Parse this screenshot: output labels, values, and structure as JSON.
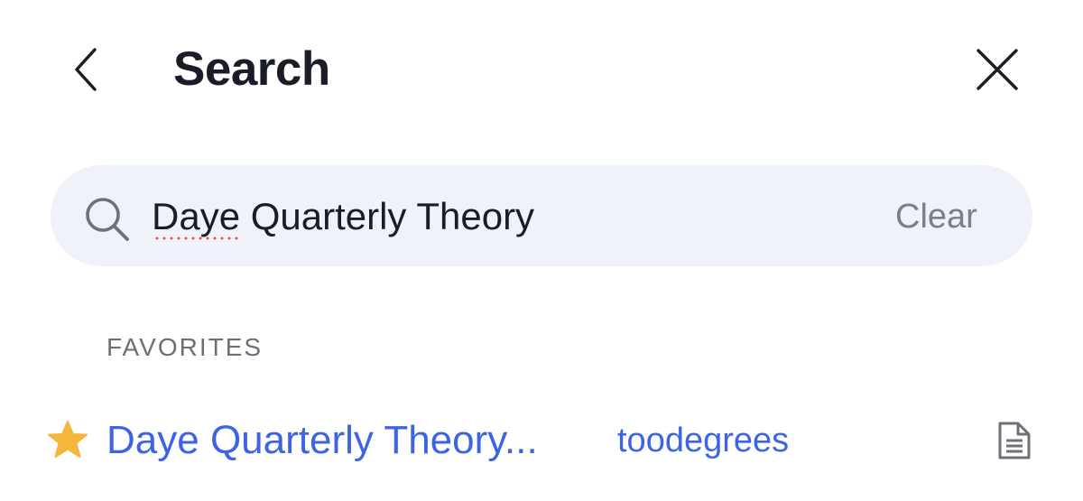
{
  "header": {
    "title": "Search",
    "back_icon": "chevron-left-icon",
    "close_icon": "close-icon"
  },
  "search": {
    "icon": "search-icon",
    "value": "Daye Quarterly Theory",
    "clear_label": "Clear",
    "misspelled_word": "Daye"
  },
  "favorites": {
    "section_label": "FAVORITES",
    "items": [
      {
        "title": "Daye Quarterly Theory...",
        "owner": "toodegrees",
        "starred": true,
        "star_icon": "star-icon",
        "type_icon": "document-icon"
      }
    ]
  },
  "colors": {
    "accent": "#3d64e4",
    "star": "#f4b63c",
    "search_bg": "#eff2f9",
    "muted_text": "#7d7f86",
    "title_text": "#1b1c2a",
    "spellcheck": "#e5474a"
  }
}
